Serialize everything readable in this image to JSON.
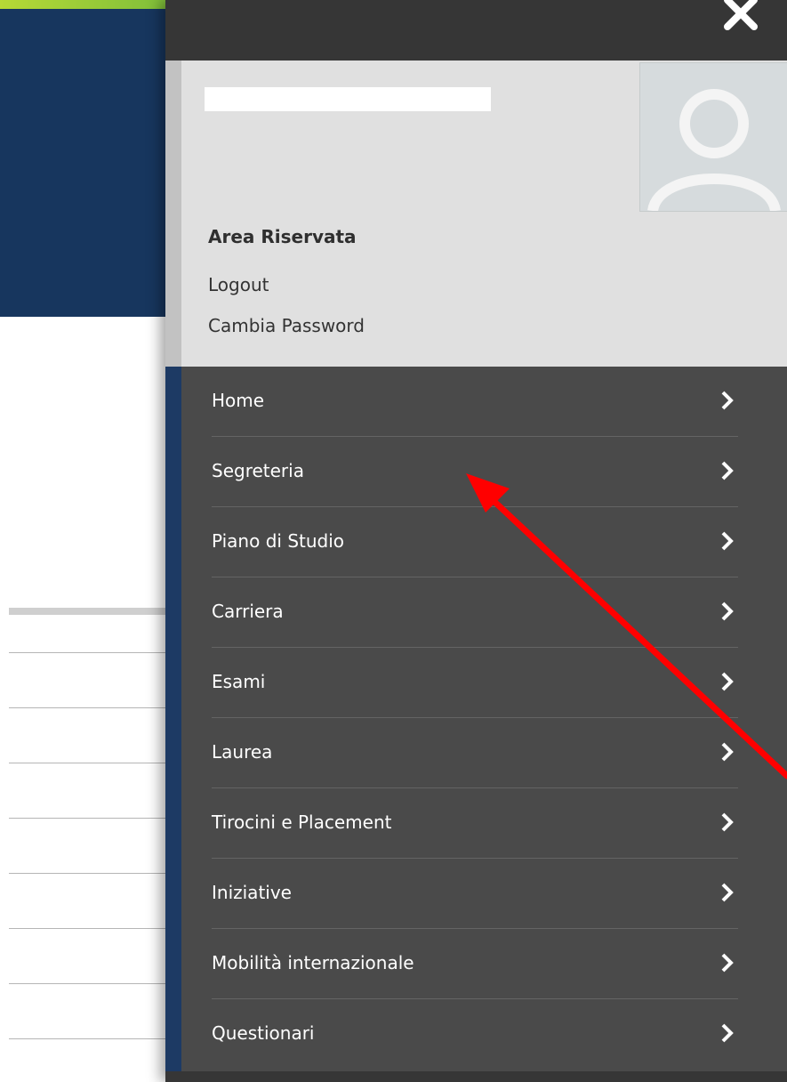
{
  "background_page": {
    "header_color": "#17365e",
    "accent_color": "#b6d936"
  },
  "drawer": {
    "close_icon": "close-icon",
    "profile": {
      "avatar_icon": "user-avatar-icon",
      "section_title": "Area Riservata",
      "links": [
        "Logout",
        "Cambia Password"
      ]
    },
    "menu": {
      "chevron_icon": "chevron-right-icon",
      "items": [
        {
          "label": "Home"
        },
        {
          "label": "Segreteria"
        },
        {
          "label": "Piano di Studio"
        },
        {
          "label": "Carriera"
        },
        {
          "label": "Esami"
        },
        {
          "label": "Laurea"
        },
        {
          "label": "Tirocini e Placement"
        },
        {
          "label": "Iniziative"
        },
        {
          "label": "Mobilità internazionale"
        },
        {
          "label": "Questionari"
        }
      ]
    },
    "colors": {
      "menu_bg": "#4a4a4a",
      "menu_accent": "#1d3a64",
      "profile_bg": "#e0e0e0"
    }
  },
  "annotation": {
    "arrow_color": "#ff0000",
    "points_to": "Segreteria"
  }
}
